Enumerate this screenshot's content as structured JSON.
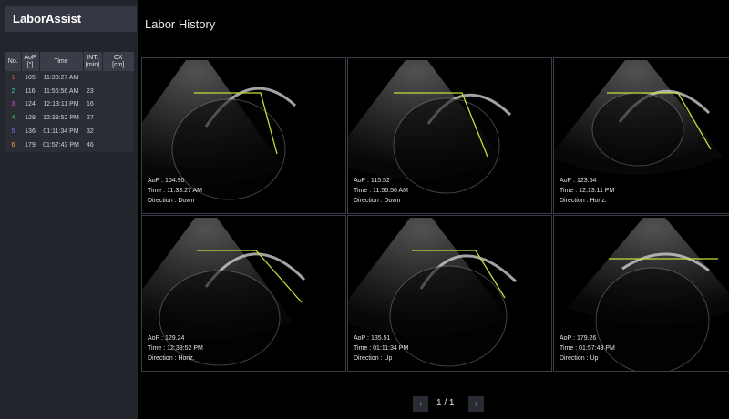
{
  "app": {
    "title": "LaborAssist"
  },
  "main": {
    "title": "Labor History"
  },
  "table": {
    "headers": [
      {
        "lines": [
          "No."
        ]
      },
      {
        "lines": [
          "AoP",
          "[°]"
        ]
      },
      {
        "lines": [
          "Time"
        ]
      },
      {
        "lines": [
          "INT.",
          "[min]"
        ]
      },
      {
        "lines": [
          "CX",
          "[cm]"
        ]
      }
    ],
    "rows": [
      {
        "no": "1",
        "color": "#e8572a",
        "aop": "105",
        "time": "11:33:27 AM",
        "int": "",
        "cx": ""
      },
      {
        "no": "2",
        "color": "#3fd3c2",
        "aop": "116",
        "time": "11:56:56 AM",
        "int": "23",
        "cx": ""
      },
      {
        "no": "3",
        "color": "#d04fd8",
        "aop": "124",
        "time": "12:13:11 PM",
        "int": "16",
        "cx": ""
      },
      {
        "no": "4",
        "color": "#4cd45a",
        "aop": "129",
        "time": "12:39:52 PM",
        "int": "27",
        "cx": ""
      },
      {
        "no": "5",
        "color": "#8f6cf0",
        "aop": "136",
        "time": "01:11:34 PM",
        "int": "32",
        "cx": ""
      },
      {
        "no": "6",
        "color": "#f2a63a",
        "aop": "179",
        "time": "01:57:43 PM",
        "int": "46",
        "cx": ""
      }
    ]
  },
  "images": [
    {
      "aop": "AoP : 104.90",
      "time": "Time : 11:33:27 AM",
      "direction": "Direction : Down"
    },
    {
      "aop": "AoP : 115.52",
      "time": "Time : 11:56:56 AM",
      "direction": "Direction : Down"
    },
    {
      "aop": "AoP : 123.54",
      "time": "Time : 12:13:11 PM",
      "direction": "Direction : Horiz."
    },
    {
      "aop": "AoP : 129.24",
      "time": "Time : 12:39:52 PM",
      "direction": "Direction : Horiz."
    },
    {
      "aop": "AoP : 135.51",
      "time": "Time : 01:11:34 PM",
      "direction": "Direction : Up"
    },
    {
      "aop": "AoP : 179.26",
      "time": "Time : 01:57:43 PM",
      "direction": "Direction : Up"
    }
  ],
  "pagination": {
    "text": "1 / 1",
    "prev_icon": "chevron-left-icon",
    "next_icon": "chevron-right-icon"
  },
  "colors": {
    "measure_line": "#c8dc3c",
    "sidebar_bg": "#23252d"
  }
}
